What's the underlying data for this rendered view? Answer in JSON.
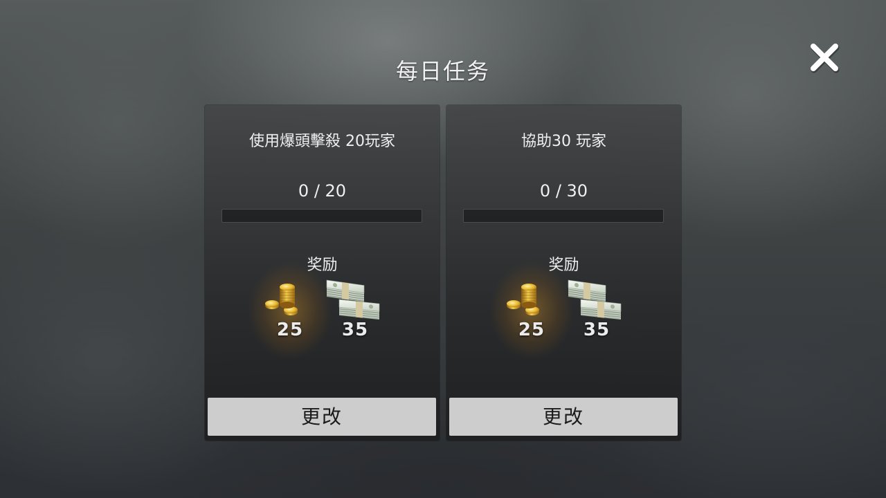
{
  "header": {
    "title": "每日任务",
    "close_icon": "close-icon"
  },
  "tasks": [
    {
      "title": "使用爆頭擊殺 20玩家",
      "progress_text": "0 / 20",
      "progress_fraction": 0,
      "reward_label": "奖励",
      "rewards": [
        {
          "icon": "gold-coins-icon",
          "value": "25"
        },
        {
          "icon": "cash-stacks-icon",
          "value": "35"
        }
      ],
      "button_label": "更改"
    },
    {
      "title": "協助30 玩家",
      "progress_text": "0 / 30",
      "progress_fraction": 0,
      "reward_label": "奖励",
      "rewards": [
        {
          "icon": "gold-coins-icon",
          "value": "25"
        },
        {
          "icon": "cash-stacks-icon",
          "value": "35"
        }
      ],
      "button_label": "更改"
    }
  ],
  "colors": {
    "button_bg": "#cdcdcd",
    "text": "#f0f0f0",
    "gold": "#e0b030",
    "cash": "#e8ece6"
  }
}
